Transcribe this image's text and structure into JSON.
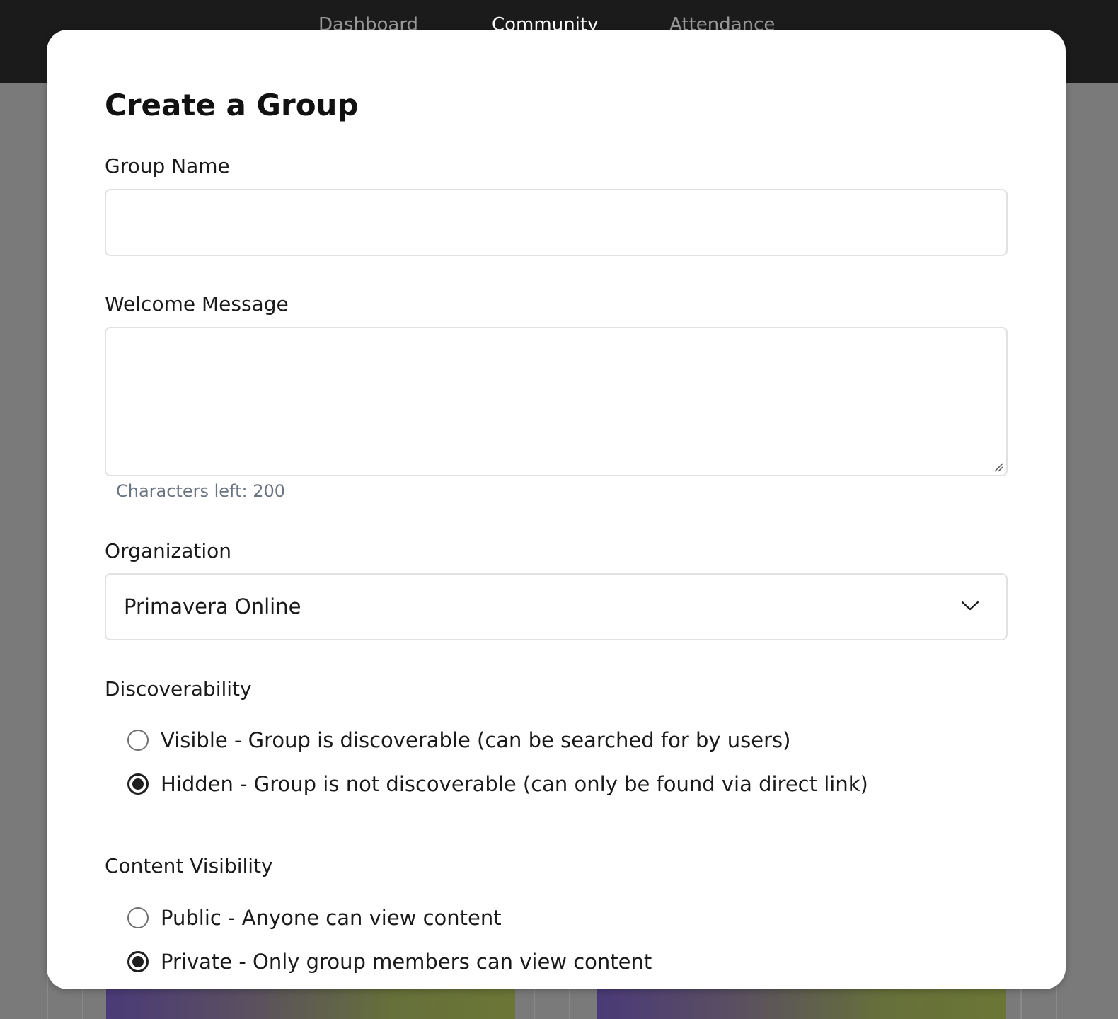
{
  "nav": {
    "tabs": [
      {
        "label": "Dashboard",
        "active": false
      },
      {
        "label": "Community",
        "active": true
      },
      {
        "label": "Attendance",
        "active": false
      }
    ]
  },
  "modal": {
    "title": "Create a Group",
    "group_name": {
      "label": "Group Name",
      "value": ""
    },
    "welcome_message": {
      "label": "Welcome Message",
      "value": "",
      "char_count": "Characters left: 200"
    },
    "organization": {
      "label": "Organization",
      "selected": "Primavera Online"
    },
    "discoverability": {
      "label": "Discoverability",
      "options": [
        {
          "label": "Visible - Group is discoverable (can be searched for by users)",
          "checked": false
        },
        {
          "label": "Hidden - Group is not discoverable (can only be found via direct link)",
          "checked": true
        }
      ]
    },
    "content_visibility": {
      "label": "Content Visibility",
      "options": [
        {
          "label": "Public - Anyone can view content",
          "checked": false
        },
        {
          "label": "Private - Only group members can view content",
          "checked": true
        }
      ]
    }
  },
  "colors": {
    "topbar": "#1b1b1b",
    "overlay": "#7a7a7a",
    "modal_bg": "#ffffff",
    "input_border": "#e1e1e1",
    "helper_text": "#6b7482"
  }
}
